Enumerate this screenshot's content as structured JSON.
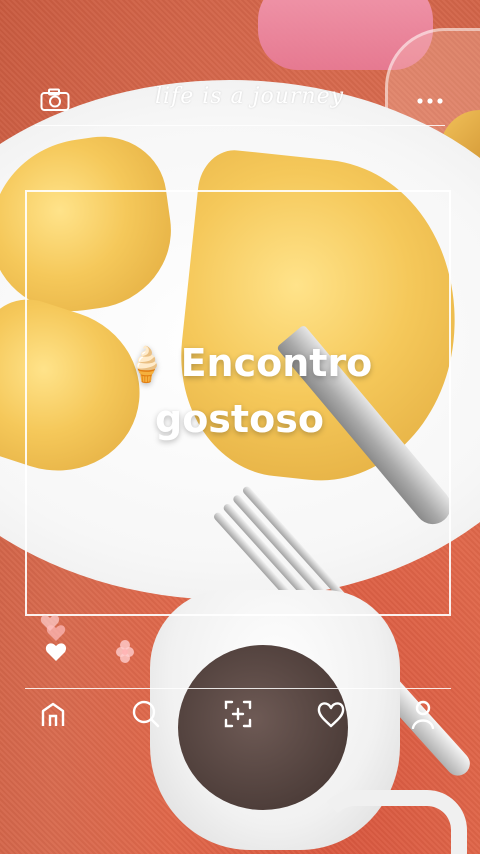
{
  "header": {
    "title": "life is a journey",
    "left_icon": "camera-icon",
    "right_icon": "more-icon"
  },
  "post": {
    "caption_emoji": "🍦",
    "caption_line1": "Encontro",
    "caption_line2": "gostoso"
  },
  "reactions": {
    "icons": [
      "heart-icon",
      "flower-icon"
    ]
  },
  "nav": {
    "items": [
      "home-icon",
      "search-icon",
      "add-post-icon",
      "heart-icon",
      "profile-icon"
    ]
  },
  "colors": {
    "overlay": "#ffffff",
    "tablecloth": "#e0674a"
  }
}
